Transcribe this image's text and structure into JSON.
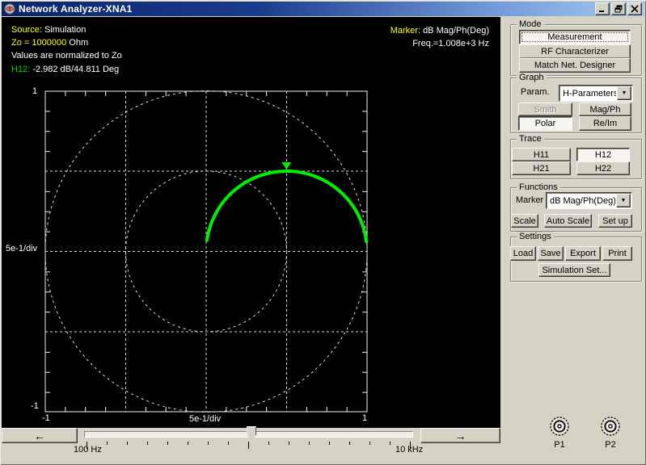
{
  "window": {
    "title": "Network Analyzer-XNA1",
    "controls": {
      "minimize": "minimize",
      "restore": "restore",
      "close": "close"
    }
  },
  "plot": {
    "status": [
      {
        "label": "Source:",
        "value": "Simulation"
      },
      {
        "label": "Zo = 1000000",
        "value": "Ohm"
      },
      {
        "label": "",
        "value": "Values are normalized to Zo"
      },
      {
        "label": "H12:",
        "value": "-2.982 dB/44.811 Deg"
      }
    ],
    "marker_readout": {
      "label": "Marker:",
      "value": "dB Mag/Ph(Deg)",
      "freq": "Freq.=1.008e+3 Hz"
    },
    "axis_labels": {
      "top_left": "1",
      "left_div": "5e-1/div",
      "left_bottom": "-1",
      "bottom_left": "-1",
      "bottom_div": "5e-1/div",
      "bottom_right": "1"
    }
  },
  "chart_data": {
    "type": "line",
    "subtype": "polar-complex-plane",
    "title": "H12 polar trace",
    "axis_range": [
      -1,
      1
    ],
    "division": "5e-1/div",
    "grid_circle_radii": [
      0.5,
      1.0
    ],
    "gridlines_xy": [
      -0.5,
      0,
      0.5
    ],
    "trace": {
      "name": "H12",
      "color": "#00ee00",
      "shape": "semicircle-upper-half",
      "center_xy": [
        0.5,
        0
      ],
      "radius": 0.5,
      "start_angle_deg": 172,
      "end_angle_deg": 7
    },
    "marker": {
      "position_xy": [
        0.5,
        0.5
      ],
      "magnitude_db": -2.982,
      "phase_deg": 44.811,
      "frequency_hz": 1008,
      "color": "#00ee00"
    }
  },
  "panel": {
    "mode": {
      "label": "Mode",
      "buttons": [
        {
          "label": "Measurement",
          "active": true
        },
        {
          "label": "RF Characterizer",
          "active": false
        },
        {
          "label": "Match Net. Designer",
          "active": false
        }
      ]
    },
    "graph": {
      "label": "Graph",
      "param_label": "Param.",
      "param_value": "H-Parameters",
      "buttons": [
        {
          "label": "Smith",
          "disabled": true
        },
        {
          "label": "Mag/Ph"
        },
        {
          "label": "Polar",
          "active": true
        },
        {
          "label": "Re/Im"
        }
      ]
    },
    "trace": {
      "label": "Trace",
      "buttons": [
        {
          "label": "H11",
          "active": false
        },
        {
          "label": "H12",
          "active": true
        },
        {
          "label": "H21",
          "active": false
        },
        {
          "label": "H22",
          "active": false
        }
      ]
    },
    "functions": {
      "label": "Functions",
      "marker_label": "Marker",
      "marker_value": "dB Mag/Ph(Deg)",
      "buttons": [
        "Scale",
        "Auto Scale",
        "Set up"
      ]
    },
    "settings": {
      "label": "Settings",
      "buttons": [
        "Load",
        "Save",
        "Export",
        "Print"
      ],
      "sim_button": "Simulation Set..."
    },
    "ports": [
      {
        "label": "P1"
      },
      {
        "label": "P2"
      }
    ]
  },
  "freq_slider": {
    "min_label": "100 Hz",
    "max_label": "10 kHz"
  },
  "colors": {
    "accent_yellow": "#ffff00",
    "trace_green": "#00ee00",
    "status_green": "#00d800",
    "panel_gray": "#d6d2c6",
    "titlebar_start": "#0a246a",
    "titlebar_end": "#a6caf0"
  }
}
